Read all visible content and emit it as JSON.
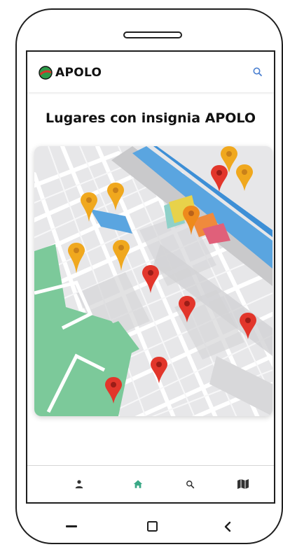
{
  "app": {
    "brand_name": "APOLO",
    "brand_colors": {
      "green": "#2e9b4a",
      "red": "#d9342b",
      "ink": "#111111"
    }
  },
  "header": {
    "search_icon": "search-icon",
    "search_color": "#4a7fd0"
  },
  "main": {
    "title": "Lugares con insignia APOLO",
    "map": {
      "pin_colors": {
        "gold": "#f0a81e",
        "red": "#e2362b"
      },
      "water_color": "#5aa5e0",
      "park_color": "#7cc99a"
    }
  },
  "bottom_nav": {
    "items": [
      {
        "name": "profile",
        "icon": "person-icon",
        "active": false
      },
      {
        "name": "home",
        "icon": "home-icon",
        "active": true
      },
      {
        "name": "search",
        "icon": "search-icon",
        "active": false
      },
      {
        "name": "map",
        "icon": "map-icon",
        "active": false
      }
    ],
    "active_color": "#3aa886",
    "inactive_color": "#333333"
  },
  "system_nav": {
    "items": [
      "recents-bar-icon",
      "home-square-icon",
      "back-chevron-icon"
    ]
  }
}
